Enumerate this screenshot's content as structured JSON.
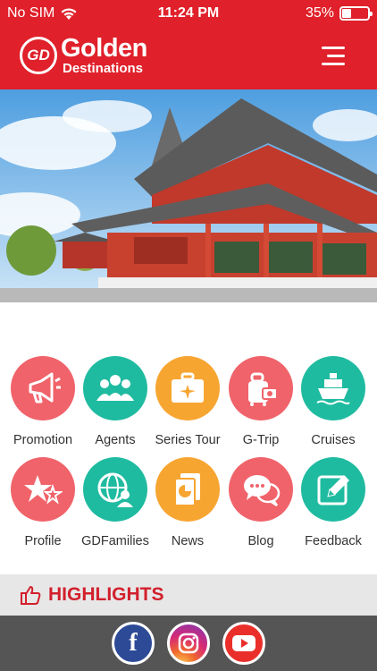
{
  "status": {
    "carrier": "No SIM",
    "time": "11:24 PM",
    "battery_text": "35%",
    "battery_level": 0.35
  },
  "header": {
    "logo_mark": "GD",
    "brand_name": "Golden",
    "brand_sub": "Destinations"
  },
  "menu": [
    {
      "label": "Promotion",
      "color": "#f0636a",
      "icon": "megaphone-icon"
    },
    {
      "label": "Agents",
      "color": "#1fbba0",
      "icon": "people-icon"
    },
    {
      "label": "Series Tour",
      "color": "#f7a531",
      "icon": "suitcase-plane-icon"
    },
    {
      "label": "G-Trip",
      "color": "#f0636a",
      "icon": "luggage-icon"
    },
    {
      "label": "Cruises",
      "color": "#1fbba0",
      "icon": "ship-icon"
    },
    {
      "label": "Profile",
      "color": "#f0636a",
      "icon": "stars-icon"
    },
    {
      "label": "GDFamilies",
      "color": "#1fbba0",
      "icon": "globe-person-icon"
    },
    {
      "label": "News",
      "color": "#f7a531",
      "icon": "newspaper-icon"
    },
    {
      "label": "Blog",
      "color": "#f0636a",
      "icon": "chat-bubbles-icon"
    },
    {
      "label": "Feedback",
      "color": "#1fbba0",
      "icon": "pencil-icon"
    }
  ],
  "highlights": {
    "title": "HIGHLIGHTS",
    "icon": "thumbs-up-icon"
  },
  "social": {
    "facebook_glyph": "f",
    "instagram_icon": "instagram-icon",
    "youtube_icon": "youtube-icon"
  },
  "colors": {
    "brand_red": "#e0202a",
    "accent_red": "#d2202c",
    "coral": "#f0636a",
    "teal": "#1fbba0",
    "orange": "#f7a531"
  }
}
